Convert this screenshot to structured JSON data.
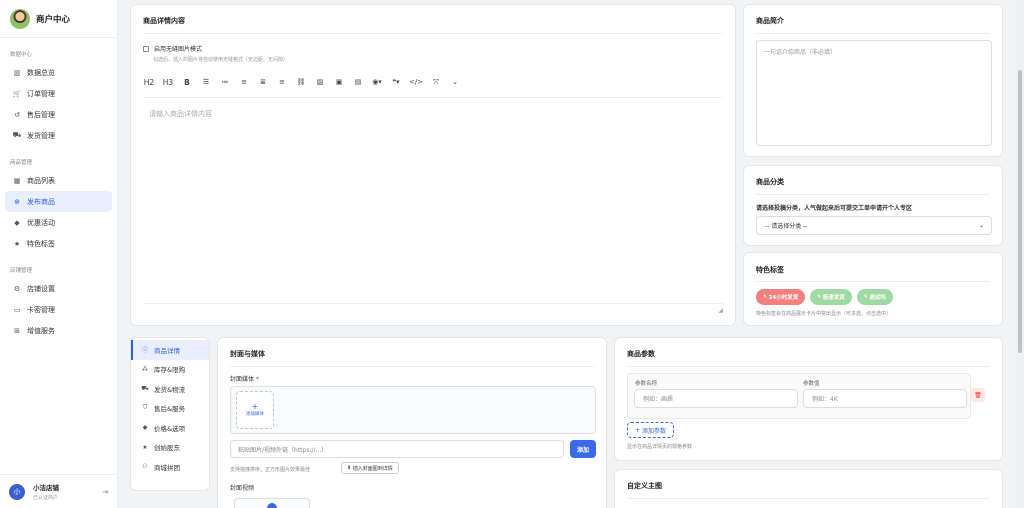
{
  "sidebar": {
    "brand": "商户中心",
    "sections": [
      {
        "title": "数据中心",
        "items": [
          {
            "label": "数据总览",
            "icon": "chart-bar-icon"
          },
          {
            "label": "订单管理",
            "icon": "cart-icon"
          },
          {
            "label": "售后管理",
            "icon": "undo-icon"
          },
          {
            "label": "发货管理",
            "icon": "truck-icon"
          }
        ]
      },
      {
        "title": "商品管理",
        "items": [
          {
            "label": "商品列表",
            "icon": "grid-icon"
          },
          {
            "label": "发布商品",
            "icon": "plus-circle-icon"
          },
          {
            "label": "优惠活动",
            "icon": "tag-icon"
          },
          {
            "label": "特色标签",
            "icon": "star-icon"
          }
        ]
      },
      {
        "title": "店铺管理",
        "items": [
          {
            "label": "店铺设置",
            "icon": "gear-icon"
          },
          {
            "label": "卡密管理",
            "icon": "card-icon"
          },
          {
            "label": "增值服务",
            "icon": "gift-icon"
          }
        ]
      }
    ],
    "user": {
      "initial": "小",
      "name": "小洁店铺",
      "role": "已认证商户"
    }
  },
  "editor": {
    "title": "商品详情内容",
    "seamless_label": "启用无缝图片模式",
    "seamless_hint": "勾选后，插入的图片将自动使用无缝格式（无边距、无间隙）",
    "toolbar": {
      "h2": "H2",
      "h3": "H3",
      "bold": "B"
    },
    "placeholder": "请输入商品详情内容"
  },
  "intro": {
    "title": "商品简介",
    "placeholder": "一句话介绍商品（非必填）"
  },
  "category": {
    "title": "商品分类",
    "note": "请选择投稿分类，人气做起来后可提交工单申请开个人专区",
    "selected": "-- 请选择分类 --"
  },
  "tags": {
    "title": "特色标签",
    "items": [
      {
        "label": "24小时发货",
        "color": "#f47f7f"
      },
      {
        "label": "极速发货",
        "color": "#9fd9a3"
      },
      {
        "label": "测试吗",
        "color": "#9fd9a3"
      }
    ],
    "hint": "特色标签会在商品展示卡片中突出显示（可多选，点击选中）"
  },
  "tabs": [
    {
      "label": "商品详情",
      "icon": "info-icon",
      "active": true
    },
    {
      "label": "库存&限购",
      "icon": "boxes-icon"
    },
    {
      "label": "发货&物流",
      "icon": "truck-icon"
    },
    {
      "label": "售后&服务",
      "icon": "shield-icon"
    },
    {
      "label": "价格&选项",
      "icon": "tag-icon"
    },
    {
      "label": "创始股东",
      "icon": "star-icon"
    },
    {
      "label": "商城拼团",
      "icon": "users-icon"
    }
  ],
  "media": {
    "title": "封面与媒体",
    "cover_label": "封面媒体",
    "required_mark": "*",
    "upload_label": "添加媒体",
    "url_placeholder": "粘贴图片/视频外链（https://...）",
    "add_label": "添加",
    "sort_hint": "支持拖拽排序，正方形图片效果最佳",
    "insert_label": "插入封面图到详情",
    "video_label": "封面视频"
  },
  "params": {
    "title": "商品参数",
    "name_header": "参数名称",
    "value_header": "参数值",
    "name_placeholder": "例如：画质",
    "value_placeholder": "例如：4K",
    "add_label": "添加参数",
    "hint": "显示在商品详情页的规格参数"
  },
  "custom": {
    "title": "自定义主图"
  }
}
